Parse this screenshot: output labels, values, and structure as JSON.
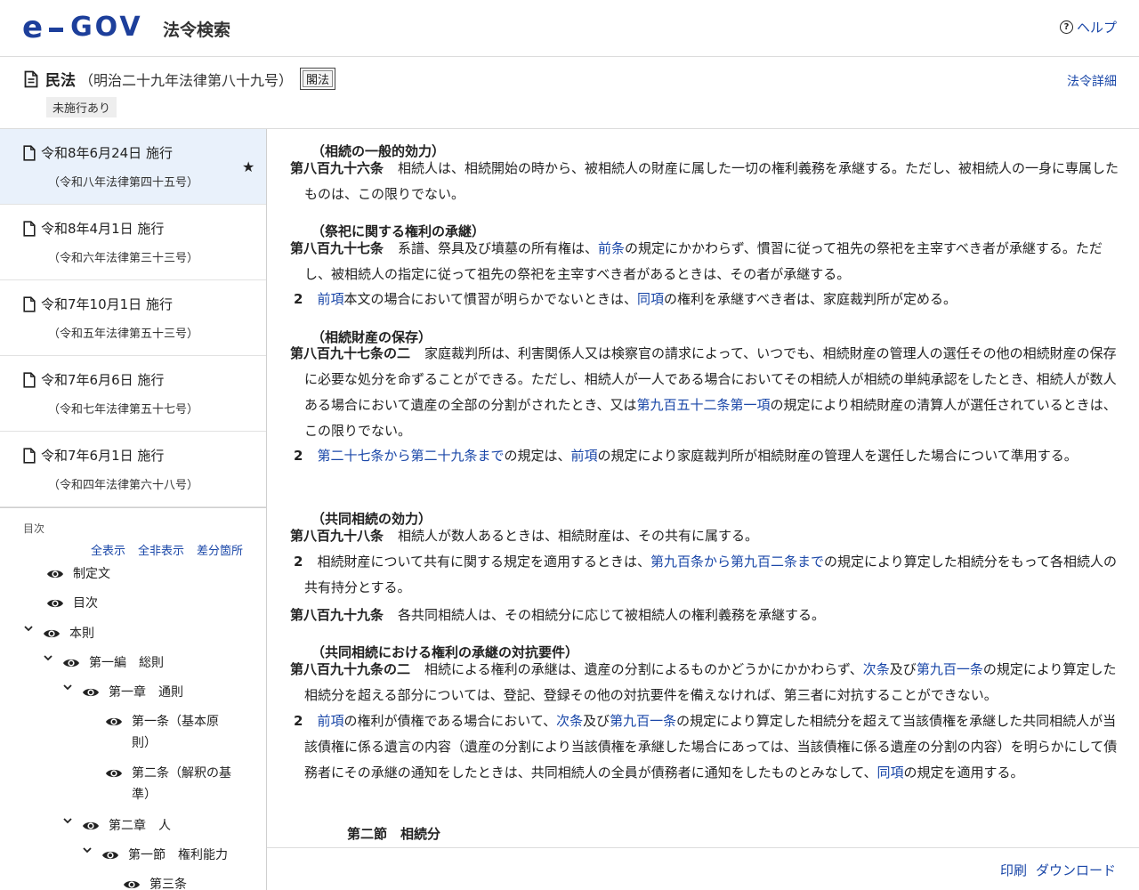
{
  "header": {
    "logo_text_e": "e",
    "logo_text_gov": "GOV",
    "subtitle": "法令検索",
    "help_label": "ヘルプ"
  },
  "law": {
    "name": "民法",
    "number": "（明治二十九年法律第八十九号）",
    "badge": "閣法",
    "status_tag": "未施行あり",
    "detail_link": "法令詳細"
  },
  "versions": [
    {
      "date": "令和8年6月24日 施行",
      "law": "（令和八年法律第四十五号）",
      "active": true
    },
    {
      "date": "令和8年4月1日 施行",
      "law": "（令和六年法律第三十三号）"
    },
    {
      "date": "令和7年10月1日 施行",
      "law": "（令和五年法律第五十三号）"
    },
    {
      "date": "令和7年6月6日 施行",
      "law": "（令和七年法律第五十七号）"
    },
    {
      "date": "令和7年6月1日 施行",
      "law": "（令和四年法律第六十八号）"
    }
  ],
  "toc": {
    "heading": "目次",
    "show_all": "全表示",
    "hide_all": "全非表示",
    "diff": "差分箇所",
    "items": [
      {
        "label": "制定文"
      },
      {
        "label": "目次"
      },
      {
        "label": "本則"
      },
      {
        "label": "第一編　総則"
      },
      {
        "label": "第一章　通則"
      },
      {
        "label": "第一条（基本原則）",
        "line1": "第一条（基本原",
        "line2": "則）"
      },
      {
        "label": "第二条（解釈の基準）",
        "line1": "第二条（解釈の基",
        "line2": "準）"
      },
      {
        "label": "第二章　人"
      },
      {
        "label": "第一節　権利能力"
      },
      {
        "label": "第三条"
      }
    ]
  },
  "content": {
    "a896": {
      "caption": "（相続の一般的効力）",
      "num": "第八百九十六条",
      "text": "相続人は、相続開始の時から、被相続人の財産に属した一切の権利義務を承継する。ただし、被相続人の一身に専属したものは、この限りでない。"
    },
    "a897": {
      "caption": "（祭祀に関する権利の承継）",
      "num": "第八百九十七条",
      "t1": "系譜、祭具及び墳墓の所有権は、",
      "l1": "前条",
      "t2": "の規定にかかわらず、慣習に従って祖先の祭祀を主宰すべき者が承継する。ただし、被相続人の指定に従って祖先の祭祀を主宰すべき者があるときは、その者が承継する。",
      "p2_num": "2",
      "p2_l1": "前項",
      "p2_t1": "本文の場合において慣習が明らかでないときは、",
      "p2_l2": "同項",
      "p2_t2": "の権利を承継すべき者は、家庭裁判所が定める。"
    },
    "a897_2": {
      "caption": "（相続財産の保存）",
      "num": "第八百九十七条の二",
      "t1": "家庭裁判所は、利害関係人又は検察官の請求によって、いつでも、相続財産の管理人の選任その他の相続財産の保存に必要な処分を命ずることができる。ただし、相続人が一人である場合においてその相続人が相続の単純承認をしたとき、相続人が数人ある場合において遺産の全部の分割がされたとき、又は",
      "l1": "第九百五十二条第一項",
      "t2": "の規定により相続財産の清算人が選任されているときは、この限りでない。",
      "p2_num": "2",
      "p2_l1": "第二十七条から第二十九条まで",
      "p2_t1": "の規定は、",
      "p2_l2": "前項",
      "p2_t2": "の規定により家庭裁判所が相続財産の管理人を選任した場合について準用する。"
    },
    "a898": {
      "caption": "（共同相続の効力）",
      "num": "第八百九十八条",
      "text": "相続人が数人あるときは、相続財産は、その共有に属する。",
      "p2_num": "2",
      "p2_t1": "相続財産について共有に関する規定を適用するときは、",
      "p2_l1": "第九百条から第九百二条まで",
      "p2_t2": "の規定により算定した相続分をもって各相続人の共有持分とする。"
    },
    "a899": {
      "num": "第八百九十九条",
      "text": "各共同相続人は、その相続分に応じて被相続人の権利義務を承継する。"
    },
    "a899_2": {
      "caption": "（共同相続における権利の承継の対抗要件）",
      "num": "第八百九十九条の二",
      "t1": "相続による権利の承継は、遺産の分割によるものかどうかにかかわらず、",
      "l1": "次条",
      "t2": "及び",
      "l2": "第九百一条",
      "t3": "の規定により算定した相続分を超える部分については、登記、登録その他の対抗要件を備えなければ、第三者に対抗することができない。",
      "p2_num": "2",
      "p2_l1": "前項",
      "p2_t1": "の権利が債権である場合において、",
      "p2_l2": "次条",
      "p2_t2": "及び",
      "p2_l3": "第九百一条",
      "p2_t3": "の規定により算定した相続分を超えて当該債権を承継した共同相続人が当該債権に係る遺言の内容（遺産の分割により当該債権を承継した場合にあっては、当該債権に係る遺産の分割の内容）を明らかにして債務者にその承継の通知をしたときは、共同相続人の全員が債務者に通知をしたものとみなして、",
      "p2_l4": "同項",
      "p2_t4": "の規定を適用する。"
    },
    "section2": "第二節　相続分"
  },
  "footer": {
    "print": "印刷",
    "download": "ダウンロード"
  },
  "colors": {
    "link": "#1a47a8",
    "brand": "#1d3f9b",
    "brand_accent": "#2aa6d8",
    "active_bg": "#e9f1fb"
  }
}
